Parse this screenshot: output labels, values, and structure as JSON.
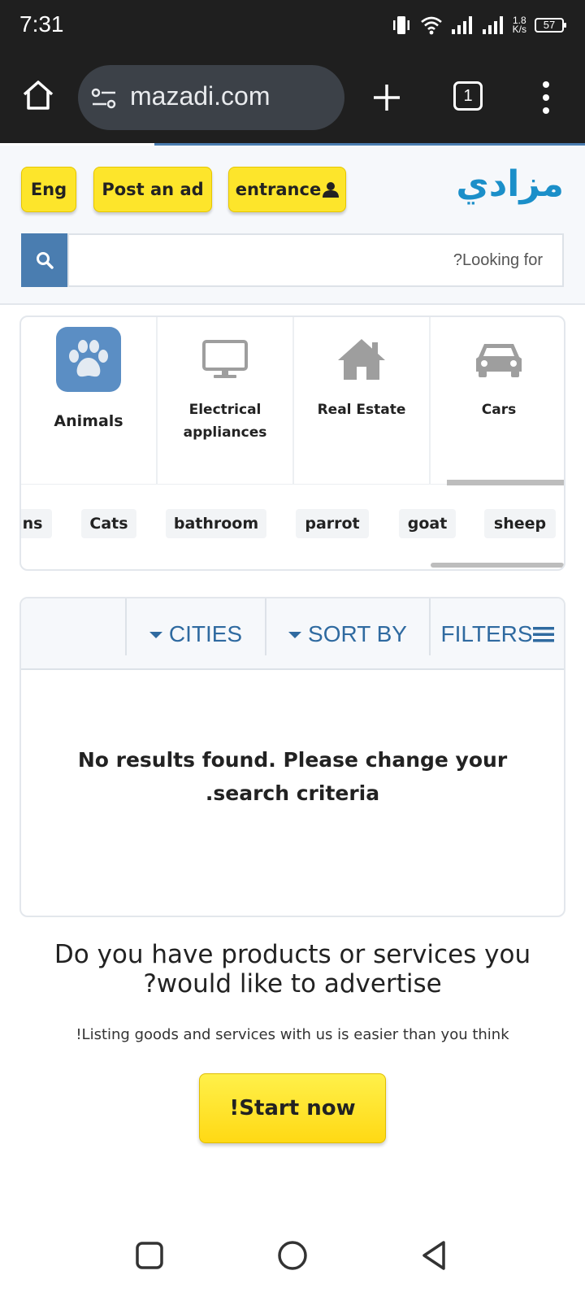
{
  "status_bar": {
    "time": "7:31",
    "net_speed_value": "1.8",
    "net_speed_unit": "K/s",
    "battery": "57"
  },
  "browser": {
    "url": "mazadi.com",
    "tab_count": "1"
  },
  "header": {
    "logo": "مزادي",
    "lang_button": "Eng",
    "post_ad_button": "Post an ad",
    "entrance_button": "entrance",
    "search_placeholder": "?Looking for"
  },
  "categories": [
    {
      "label": "Cars",
      "icon": "car-icon"
    },
    {
      "label": "Real Estate",
      "icon": "house-icon"
    },
    {
      "label": "Electrical appliances",
      "icon": "monitor-icon"
    },
    {
      "label": "Animals",
      "icon": "paw-icon",
      "active": true
    }
  ],
  "subcategories": [
    "sheep",
    "goat",
    "parrot",
    "bathroom",
    "Cats",
    "ns"
  ],
  "toolbar": {
    "filters_label": "FILTERS",
    "sort_label": "SORT BY",
    "cities_label": "CITIES"
  },
  "results": {
    "message_line1": "No results found. Please change your",
    "message_line2": ".search criteria"
  },
  "promo": {
    "title_line1": "Do you have products or services you",
    "title_line2": "?would like to advertise",
    "subtitle": "!Listing goods and services with us is easier than you think",
    "cta": "!Start now"
  },
  "colors": {
    "brand_blue": "#1b8fc9",
    "button_yellow": "#fde52b",
    "accent_blue": "#4a7db0"
  }
}
